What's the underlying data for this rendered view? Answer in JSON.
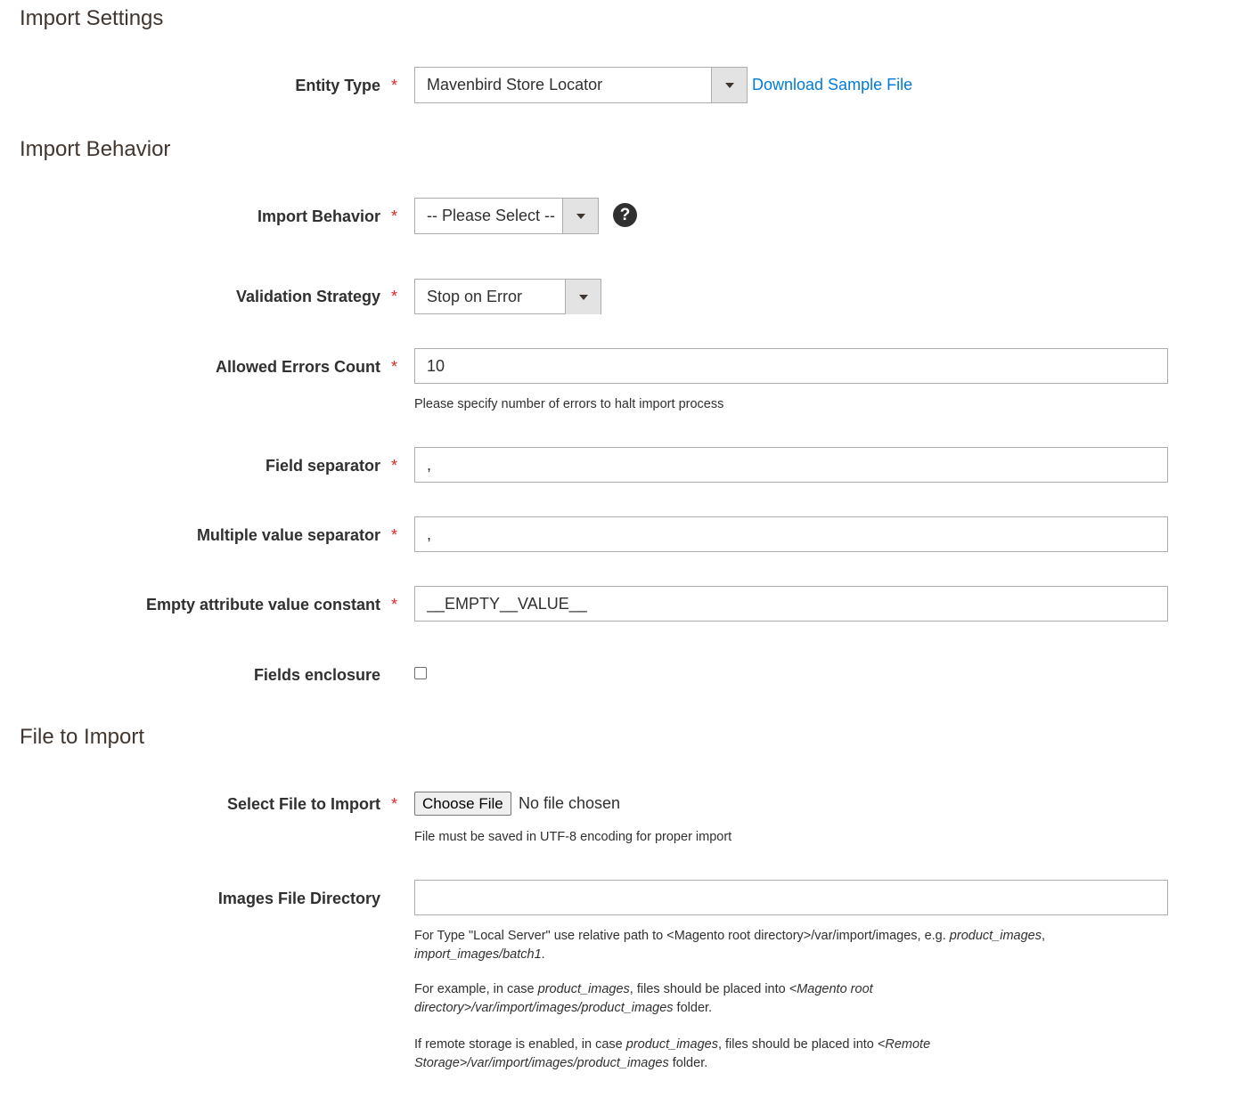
{
  "sections": {
    "import_settings": "Import Settings",
    "import_behavior": "Import Behavior",
    "file_to_import": "File to Import"
  },
  "fields": {
    "entity_type": {
      "label": "Entity Type",
      "required": "*",
      "value": "Mavenbird Store Locator",
      "download_link": "Download Sample File"
    },
    "import_behavior": {
      "label": "Import Behavior",
      "required": "*",
      "value": "-- Please Select --",
      "help": "?"
    },
    "validation_strategy": {
      "label": "Validation Strategy",
      "required": "*",
      "value": "Stop on Error"
    },
    "allowed_errors_count": {
      "label": "Allowed Errors Count",
      "required": "*",
      "value": "10",
      "note": "Please specify number of errors to halt import process"
    },
    "field_separator": {
      "label": "Field separator",
      "required": "*",
      "value": ","
    },
    "multiple_value_separator": {
      "label": "Multiple value separator",
      "required": "*",
      "value": ","
    },
    "empty_attribute_value_constant": {
      "label": "Empty attribute value constant",
      "required": "*",
      "value": "__EMPTY__VALUE__"
    },
    "fields_enclosure": {
      "label": "Fields enclosure",
      "checked": false
    },
    "select_file": {
      "label": "Select File to Import",
      "required": "*",
      "button": "Choose File",
      "status": "No file chosen",
      "note": "File must be saved in UTF-8 encoding for proper import"
    },
    "images_file_directory": {
      "label": "Images File Directory",
      "value": "",
      "note1_a": "For Type \"Local Server\" use relative path to <Magento root directory>/var/import/images, e.g. ",
      "note1_b": "product_images",
      "note1_c": ", ",
      "note1_d": "import_images/batch1",
      "note1_e": ".",
      "note2_a": "For example, in case ",
      "note2_b": "product_images",
      "note2_c": ", files should be placed into ",
      "note2_d": "<Magento root directory>/var/import/images/product_images",
      "note2_e": " folder.",
      "note3_a": "If remote storage is enabled, in case ",
      "note3_b": "product_images",
      "note3_c": ", files should be placed into ",
      "note3_d": "<Remote Storage>/var/import/images/product_images",
      "note3_e": " folder."
    }
  }
}
